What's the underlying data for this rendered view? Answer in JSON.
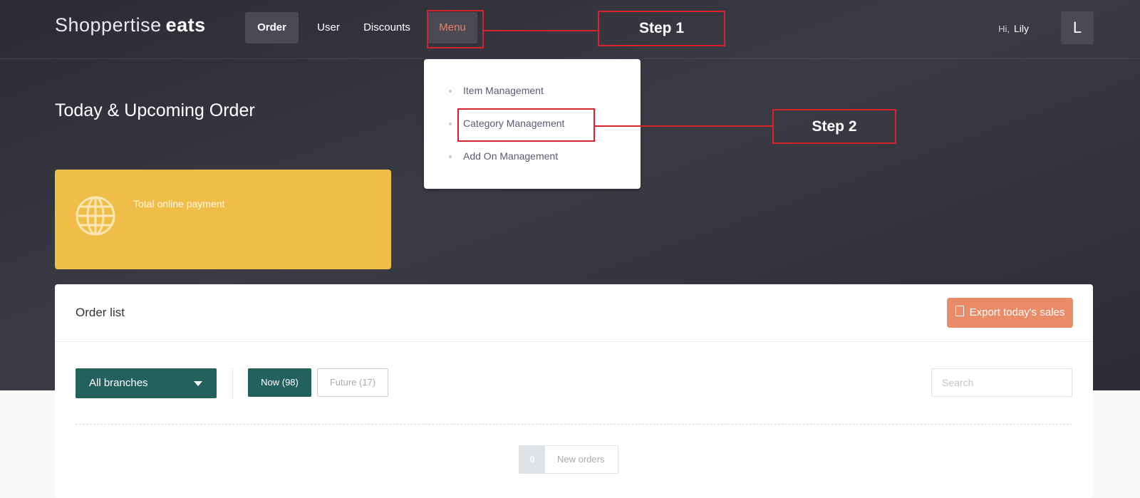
{
  "brand": {
    "name_light": "Shoppertise",
    "name_bold": "eats"
  },
  "nav": {
    "order": "Order",
    "user": "User",
    "discounts": "Discounts",
    "menu": "Menu"
  },
  "user_menu": {
    "greeting": "Hi,",
    "name": "Lily",
    "avatar_initial": "L"
  },
  "menu_dropdown": {
    "items": [
      {
        "label": "Item Management"
      },
      {
        "label": "Category Management"
      },
      {
        "label": "Add On Management"
      }
    ]
  },
  "page": {
    "title": "Today & Upcoming Order"
  },
  "summary_card": {
    "label": "Total online payment",
    "icon": "globe-icon",
    "color": "#f0bd48"
  },
  "order_list": {
    "title": "Order list",
    "export_label": "Export today's sales",
    "branch_select": "All branches",
    "tabs": {
      "now": "Now (98)",
      "future": "Future (17)"
    },
    "search": {
      "placeholder": "Search",
      "value": ""
    },
    "new_orders": {
      "count": "0",
      "label": "New orders"
    }
  },
  "annotations": {
    "step1": "Step 1",
    "step2": "Step 2",
    "color": "#d6232a"
  },
  "colors": {
    "accent": "#ea8b67",
    "primary": "#23615f",
    "menu_active": "#e8836a"
  }
}
